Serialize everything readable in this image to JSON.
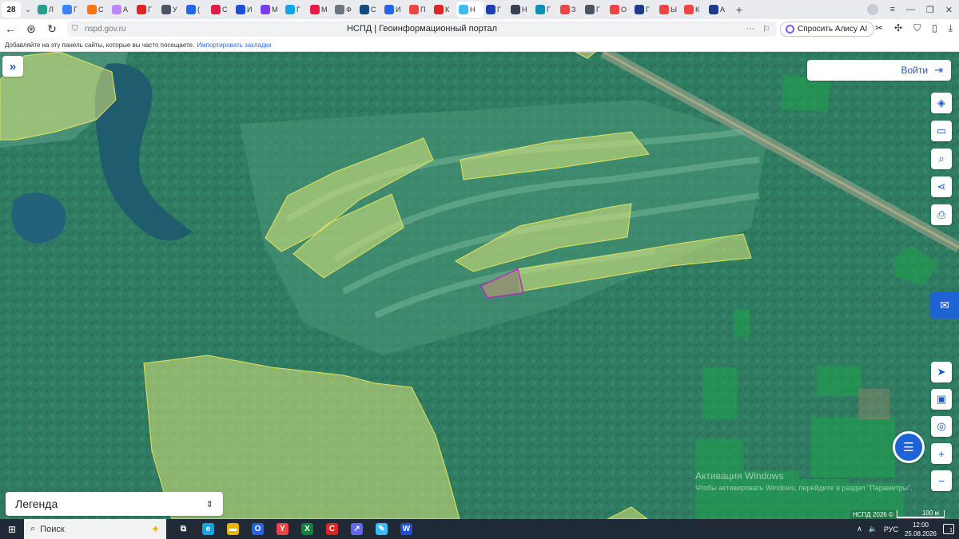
{
  "browser": {
    "tab_count": "28",
    "tabs": [
      {
        "label": "Л",
        "color": "#2a9d8f"
      },
      {
        "label": "Г",
        "color": "#3b82f6"
      },
      {
        "label": "С",
        "color": "#f97316"
      },
      {
        "label": "А",
        "color": "#c084fc"
      },
      {
        "label": "Г",
        "color": "#dc2626"
      },
      {
        "label": "У",
        "color": "#4b5563"
      },
      {
        "label": "(",
        "color": "#2563eb"
      },
      {
        "label": "С",
        "color": "#e11d48"
      },
      {
        "label": "И",
        "color": "#1d4ed8"
      },
      {
        "label": "М",
        "color": "#7c3aed"
      },
      {
        "label": "Г",
        "color": "#0ea5e9"
      },
      {
        "label": "М",
        "color": "#e11d48"
      },
      {
        "label": "Ф",
        "color": "#6b7280"
      },
      {
        "label": "С",
        "color": "#0f4c81"
      },
      {
        "label": "И",
        "color": "#2563eb"
      },
      {
        "label": "П",
        "color": "#ef4444"
      },
      {
        "label": "К",
        "color": "#dc2626"
      },
      {
        "label": "Н",
        "color": "#38bdf8",
        "active": true
      },
      {
        "label": "Г",
        "color": "#1e40af"
      },
      {
        "label": "Н",
        "color": "#374151"
      },
      {
        "label": "Г",
        "color": "#0891b2"
      },
      {
        "label": "З",
        "color": "#ef4444"
      },
      {
        "label": "Г",
        "color": "#4b5563"
      },
      {
        "label": "О",
        "color": "#ef4444"
      },
      {
        "label": "Г",
        "color": "#1e3a8a"
      },
      {
        "label": "Ы",
        "color": "#ef4444"
      },
      {
        "label": "К",
        "color": "#ef4444"
      },
      {
        "label": "А",
        "color": "#1e3a8a"
      }
    ],
    "url": "nspd.gov.ru",
    "page_title": "НСПД | Геоинформационный портал",
    "alice_label": "Спросить Алису AI",
    "bookmarks_text": "Добавляйте на эту панель сайты, которые вы часто посещаете.",
    "bookmarks_link": "Импортировать закладки"
  },
  "map": {
    "login_label": "Войти",
    "legend_label": "Легенда",
    "watermark_title": "Активация Windows",
    "watermark_sub": "Чтобы активировать Windows, перейдите в раздел \"Параметры\".",
    "copyright": "НСПД 2026 ©",
    "scale_label": "100 м",
    "tool_icons": [
      "layers-icon",
      "ruler-icon",
      "search-area-icon",
      "share-icon",
      "print-icon"
    ],
    "bottom_icons": [
      "locate-icon",
      "minimap-icon",
      "geolocation-icon",
      "zoom-in-icon",
      "zoom-out-icon"
    ],
    "colors": {
      "forest": "#2f7c62",
      "parcel_fill": "#d8e67a",
      "parcel_stroke": "#e5e45a",
      "selected_stroke": "#b12fb3",
      "accent": "#1d63d6"
    }
  },
  "taskbar": {
    "search_label": "Поиск",
    "language": "РУС",
    "time": "12:00",
    "date": "25.08.2026",
    "notifications": "1",
    "apps": [
      {
        "name": "task-view",
        "glyph": "⧉",
        "color": "#1f2a36"
      },
      {
        "name": "edge",
        "glyph": "e",
        "color": "#0ea5e9"
      },
      {
        "name": "explorer",
        "glyph": "▬",
        "color": "#eab308"
      },
      {
        "name": "outlook",
        "glyph": "O",
        "color": "#2563eb"
      },
      {
        "name": "yandex-browser",
        "glyph": "Y",
        "color": "#ef4444"
      },
      {
        "name": "excel",
        "glyph": "X",
        "color": "#15803d"
      },
      {
        "name": "app-c",
        "glyph": "C",
        "color": "#dc2626"
      },
      {
        "name": "app-arrow",
        "glyph": "↗",
        "color": "#6366f1"
      },
      {
        "name": "app-feather",
        "glyph": "✎",
        "color": "#38bdf8"
      },
      {
        "name": "word",
        "glyph": "W",
        "color": "#1d4ed8"
      }
    ]
  }
}
